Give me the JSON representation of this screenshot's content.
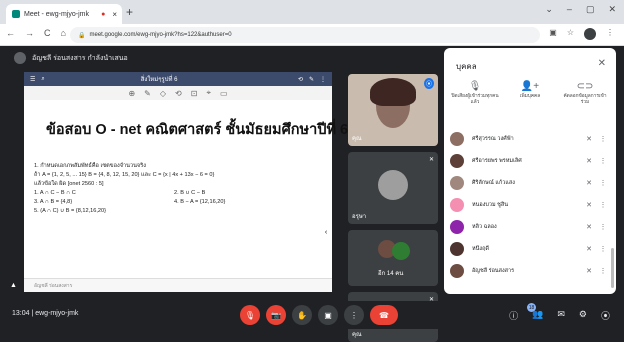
{
  "browser": {
    "tab_title": "Meet - ewg-mjyo-jmk",
    "tab_recording": "●",
    "tab_close": "×",
    "new_tab": "+",
    "win_controls": [
      "⌄",
      "–",
      "▢",
      "✕"
    ],
    "nav": [
      "←",
      "→",
      "C",
      "⌂"
    ],
    "url": "meet.google.com/ewg-mjyo-jmk?hs=122&authuser=0",
    "lock": "🔒",
    "addr_icons": [
      "▣",
      "☆",
      "⋮"
    ]
  },
  "meet": {
    "presenter_label": "อัญชลี ร่อนสงสาร กำลังนำเสนอ",
    "share": {
      "toolbar_title": "สิ่งใหม่ๆรูปที่ 6",
      "toolbar_icons": [
        "☰",
        "⌕",
        "⟲",
        "✎",
        "⋮"
      ],
      "tools": [
        "⊕",
        "✎",
        "◇",
        "⟲",
        "⊡",
        "⌖",
        "▭"
      ],
      "title": "ข้อสอบ O - net  คณิตศาสตร์  ชั้นมัธยมศึกษาปีที่ 6",
      "lines": [
        "1.  กำหนดเอกภพสัมพัทธ์คือ เซตของจำนวนจริง",
        "ถ้า    A = {1, 2, 5, ... 15}          B = {4, 8, 12, 15, 20}     และ    C = {x | 4x + 13x − 6 = 0}",
        "แล้วข้อใด ผิด  [onet 2560 : 5]"
      ],
      "choices": [
        [
          "1.   A ∩ C − B ∩ C",
          "2.   B ∪ C − B"
        ],
        [
          "3.   A ∩ B = {4,8}",
          "4.   B − A = {12,16,20}"
        ],
        [
          "5.   (A ∩ C) ∪ B = {8,12,16,20}",
          ""
        ]
      ],
      "footer": "อัญชลี ร่อนสงสาร"
    },
    "tiles": [
      {
        "name": "คุณ",
        "mic": "⦿"
      },
      {
        "name": "อรุษา",
        "mic": "✕"
      },
      {
        "name": "อีก 14 คน",
        "mic": ""
      },
      {
        "name": "คุณ",
        "mic": "✕"
      }
    ],
    "collapse": "‹"
  },
  "panel": {
    "title": "บุคคล",
    "close": "✕",
    "actions": [
      {
        "icon": "🎙",
        "label": "ปิดเสียงผู้เข้าร่วมทุกคนแล้ว"
      },
      {
        "icon": "👤+",
        "label": "เพิ่มบุคคล"
      },
      {
        "icon": "⊂⊃",
        "label": "คัดลอกข้อมูลการเข้าร่วม"
      }
    ],
    "people": [
      {
        "name": "ศรีสุวรรณ วงศ์ฟ้า",
        "avatar": "#8d6e63"
      },
      {
        "name": "ศรีอารยพร พรหมเลิศ",
        "avatar": "#5d4037"
      },
      {
        "name": "ศิริลักษณ์ แก้วแสง",
        "avatar": "#a1887f"
      },
      {
        "name": "หนองบวม ชูสิน",
        "avatar": "#f48fb1"
      },
      {
        "name": "หลิว ฉลอง",
        "avatar": "#8e24aa"
      },
      {
        "name": "หนึ่งฤดี",
        "avatar": "#4e342e"
      },
      {
        "name": "อัญชลี ร่อนสงสาร",
        "avatar": "#6d4c41"
      }
    ],
    "mic_icon": "✕",
    "more_icon": "⋮"
  },
  "bottom": {
    "time_code": "13:04  |  ewg-mjyo-jmk",
    "controls": [
      "🎙",
      "📷",
      "✋",
      "▣",
      "⋮",
      "☎"
    ],
    "right_icons": [
      "ⓘ",
      "👥",
      "✉",
      "⚙",
      "⦿"
    ],
    "participants_count": "18"
  }
}
